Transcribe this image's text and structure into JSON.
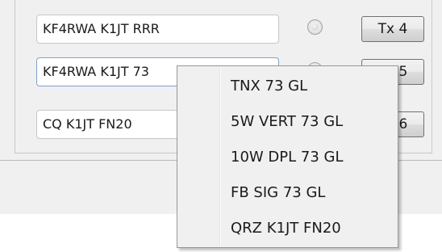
{
  "tx_rows": [
    {
      "message": "KF4RWA K1JT RRR",
      "button_label": "Tx 4"
    },
    {
      "message": "KF4RWA K1JT 73",
      "button_label": "Tx 5"
    },
    {
      "message": "CQ K1JT FN20",
      "button_label": "Tx 6"
    }
  ],
  "context_menu": {
    "items": [
      {
        "label": "TNX 73 GL"
      },
      {
        "label": "5W VERT 73 GL"
      },
      {
        "label": "10W DPL 73 GL"
      },
      {
        "label": "FB SIG 73 GL"
      },
      {
        "label": "QRZ K1JT FN20"
      }
    ]
  }
}
